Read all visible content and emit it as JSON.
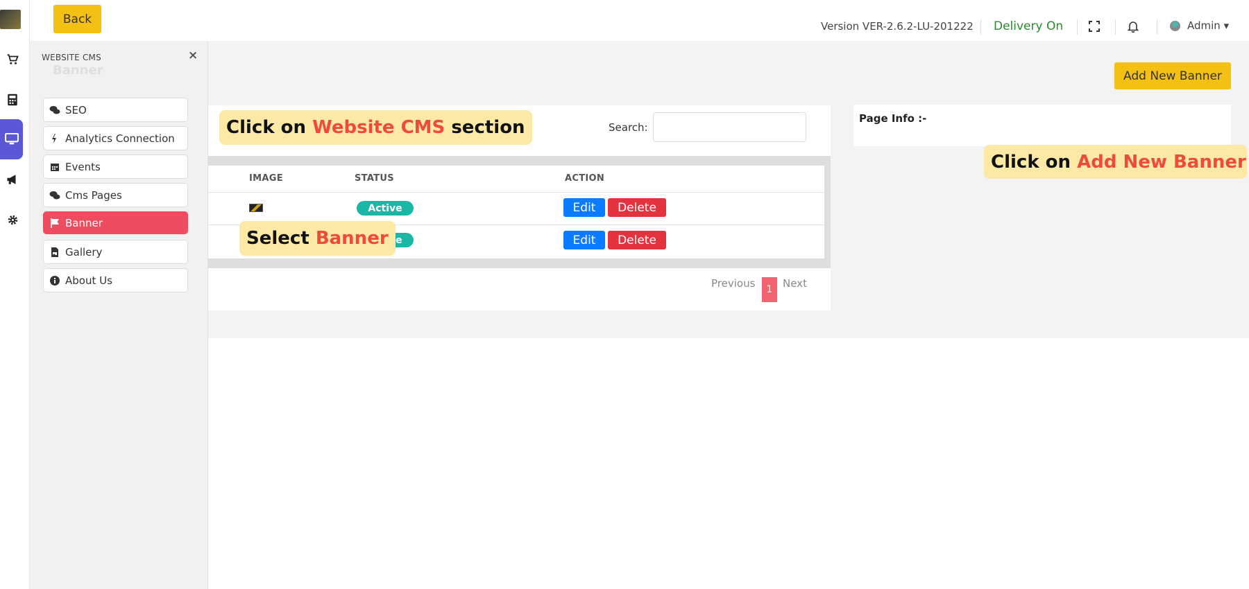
{
  "topbar": {
    "back_label": "Back",
    "version": "Version VER-2.6.2-LU-201222",
    "delivery": "Delivery On",
    "admin": "Admin ▾"
  },
  "sidebar": {
    "title": "WEBSITE CMS",
    "ghost_title": "Banner",
    "close": "×",
    "items": [
      {
        "label": "SEO",
        "icon": "comments-icon"
      },
      {
        "label": "Analytics Connection",
        "icon": "plug-icon"
      },
      {
        "label": "Events",
        "icon": "calendar-icon"
      },
      {
        "label": "Cms Pages",
        "icon": "comments-icon"
      },
      {
        "label": "Banner",
        "icon": "flag-icon",
        "active": true
      },
      {
        "label": "Gallery",
        "icon": "file-image-icon"
      },
      {
        "label": "About Us",
        "icon": "info-circle-icon"
      }
    ]
  },
  "main": {
    "add_banner_label": "Add New Banner",
    "search_label": "Search:",
    "search_value": "",
    "table": {
      "headers": [
        "IMAGE",
        "STATUS",
        "ACTION"
      ],
      "rows": [
        {
          "status": "Active",
          "edit": "Edit",
          "delete": "Delete"
        },
        {
          "status": "Active",
          "edit": "Edit",
          "delete": "Delete"
        }
      ]
    },
    "pagination": {
      "previous": "Previous",
      "current": "1",
      "next": "Next"
    },
    "page_info_label": "Page Info :-"
  },
  "callouts": {
    "cms": {
      "prefix": "Click on ",
      "highlight": "Website CMS",
      "suffix": " section"
    },
    "banner": {
      "prefix": "Select ",
      "highlight": "Banner"
    },
    "add": {
      "prefix": "Click on ",
      "highlight": "Add New Banner"
    }
  },
  "colors": {
    "accent_yellow": "#f5c014",
    "active_menu": "#ee4d5f",
    "rail_active": "#5b57d6",
    "status_active": "#1ab7a6",
    "edit_blue": "#0b7bff",
    "delete_red": "#e5323f",
    "delivery_green": "#2a8a2a",
    "callout_bg": "#fde9a6",
    "callout_highlight": "#ef4a3a"
  }
}
